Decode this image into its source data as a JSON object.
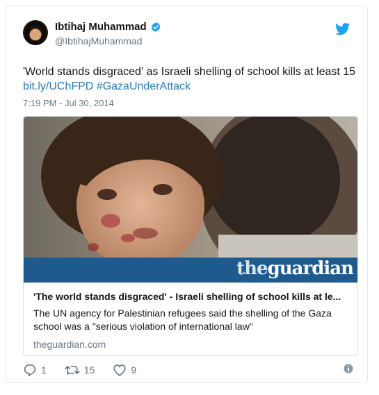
{
  "user": {
    "name": "Ibtihaj Muhammad",
    "handle": "@IbtihajMuhammad"
  },
  "tweet": {
    "text_line1": "'World stands disgraced' as Israeli shelling of school kills at least 15",
    "link": "bit.ly/UChFPD",
    "hashtag": "#GazaUnderAttack",
    "timestamp": "7:19 PM - Jul 30, 2014"
  },
  "card": {
    "brand_the": "the",
    "brand_guardian": "guardian",
    "title": "'The world stands disgraced' - Israeli shelling of school kills at le...",
    "description": "The UN agency for Palestinian refugees said the shelling of the Gaza school was a \"serious violation of international law\"",
    "domain": "theguardian.com"
  },
  "actions": {
    "replies": "1",
    "retweets": "15",
    "likes": "9"
  },
  "colors": {
    "link": "#2b7bb9",
    "verified": "#1da1f2",
    "twitter_bird": "#1da1f2",
    "guardian_bar": "#1f5a8f",
    "muted": "#657786"
  },
  "icons": [
    "verified-icon",
    "twitter-bird-icon",
    "reply-icon",
    "retweet-icon",
    "like-icon",
    "info-icon"
  ]
}
